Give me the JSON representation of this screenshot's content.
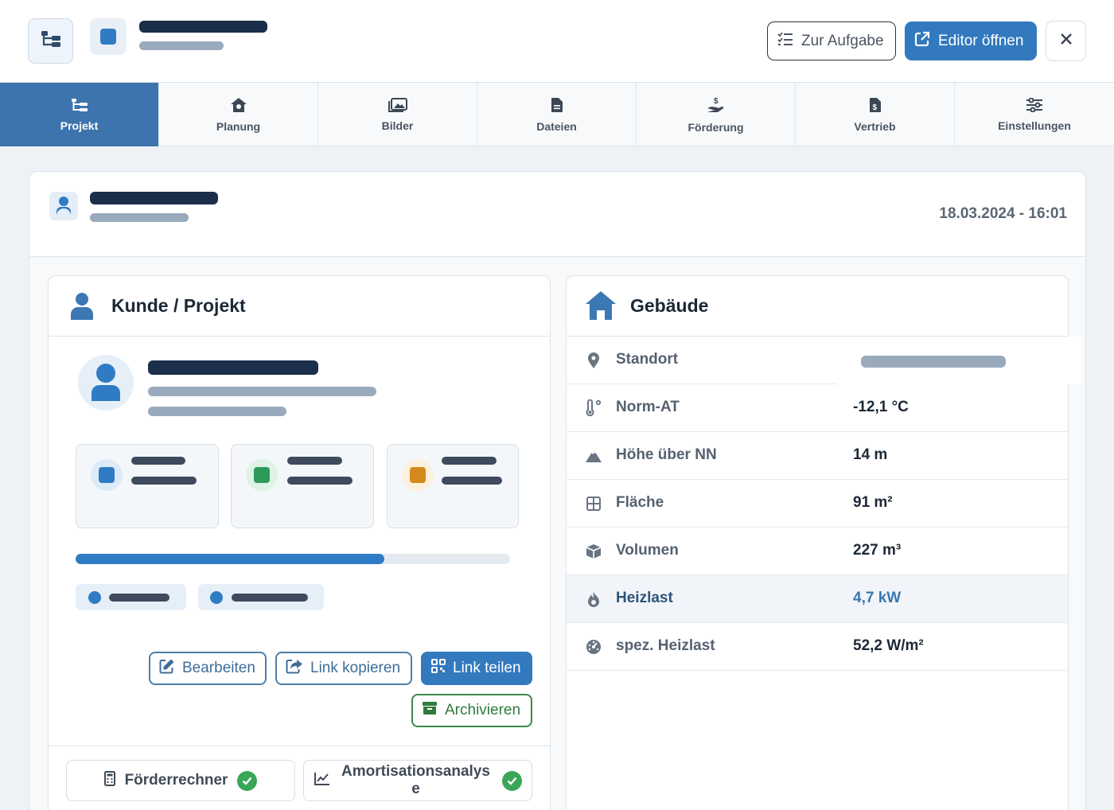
{
  "header": {
    "zur_aufgabe_label": "Zur Aufgabe",
    "editor_label": "Editor öffnen",
    "close_label": "✕"
  },
  "tabs": [
    {
      "label": "Projekt",
      "icon": "sitemap-icon",
      "active": true
    },
    {
      "label": "Planung",
      "icon": "house-gear-icon"
    },
    {
      "label": "Bilder",
      "icon": "images-icon"
    },
    {
      "label": "Dateien",
      "icon": "file-icon"
    },
    {
      "label": "Förderung",
      "icon": "hand-dollar-icon"
    },
    {
      "label": "Vertrieb",
      "icon": "invoice-dollar-icon"
    },
    {
      "label": "Einstellungen",
      "icon": "sliders-icon"
    }
  ],
  "project": {
    "date": "18.03.2024 - 16:01"
  },
  "customer_card": {
    "title": "Kunde / Projekt",
    "progress": 0.71,
    "actions": {
      "edit": "Bearbeiten",
      "copy_link": "Link kopieren",
      "share_link": "Link teilen",
      "archive": "Archivieren"
    },
    "footer": {
      "calculator": "Förderrechner",
      "amortization": "Amortisationsanalyse"
    }
  },
  "building_card": {
    "title": "Gebäude",
    "rows": [
      {
        "label": "Standort",
        "value": "",
        "icon": "map-pin-icon"
      },
      {
        "label": "Norm-AT",
        "value": "-12,1 °C",
        "icon": "thermometer-icon"
      },
      {
        "label": "Höhe über NN",
        "value": "14 m",
        "icon": "mountain-icon"
      },
      {
        "label": "Fläche",
        "value": "91 m²",
        "icon": "grid-area-icon"
      },
      {
        "label": "Volumen",
        "value": "227 m³",
        "icon": "cube-icon"
      },
      {
        "label": "Heizlast",
        "value": "4,7 kW",
        "icon": "flame-icon",
        "highlight": true
      },
      {
        "label": "spez. Heizlast",
        "value": "52,2 W/m²",
        "icon": "gauge-icon"
      }
    ]
  },
  "colors": {
    "primary": "#3279be",
    "tab_active": "#3d74ae",
    "dark_text": "#1c2836",
    "success": "#3aa658",
    "archive_green": "#2f7a3c"
  }
}
